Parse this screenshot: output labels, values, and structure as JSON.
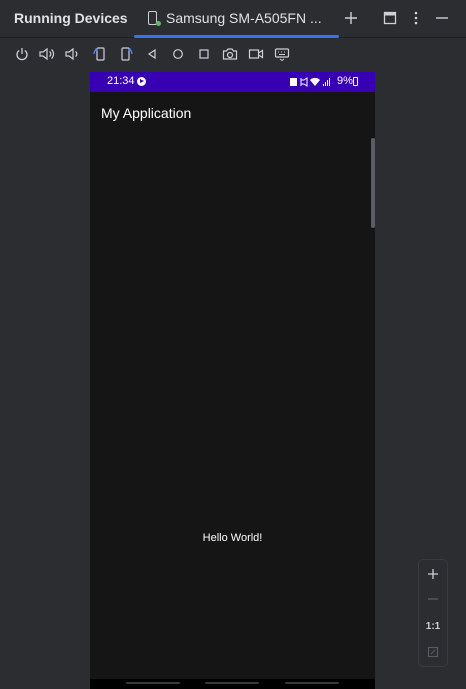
{
  "window": {
    "panel_title": "Running Devices",
    "tab_label": "Samsung SM-A505FN ...",
    "add_tab_icon": "plus-icon",
    "maximize_icon": "window-icon",
    "options_icon": "more-vertical-icon",
    "minimize_icon": "minus-icon"
  },
  "toolbar": {
    "items": [
      {
        "name": "power",
        "icon": "power-icon"
      },
      {
        "name": "volume-up",
        "icon": "volume-up-icon"
      },
      {
        "name": "volume-down",
        "icon": "volume-down-icon"
      },
      {
        "name": "rotate-left",
        "icon": "rotate-left-icon"
      },
      {
        "name": "rotate-right",
        "icon": "rotate-right-icon"
      },
      {
        "name": "back",
        "icon": "back-triangle-icon"
      },
      {
        "name": "home",
        "icon": "home-circle-icon"
      },
      {
        "name": "overview",
        "icon": "overview-square-icon"
      },
      {
        "name": "screenshot",
        "icon": "camera-icon"
      },
      {
        "name": "screen-record",
        "icon": "video-camera-icon"
      },
      {
        "name": "keyboard",
        "icon": "keyboard-icon"
      }
    ]
  },
  "device": {
    "status_bar": {
      "time": "21:34",
      "battery": "9%",
      "background": "#3700b3"
    },
    "app_title": "My Application",
    "content_text": "Hello World!"
  },
  "zoom": {
    "zoom_in_icon": "plus-icon",
    "zoom_out_icon": "minus-icon",
    "actual_size_label": "1:1",
    "fit_icon": "fit-screen-icon"
  },
  "colors": {
    "accent": "#3574f0",
    "background": "#2b2d30",
    "device_bg": "#151515",
    "online_indicator": "#5fb865"
  }
}
